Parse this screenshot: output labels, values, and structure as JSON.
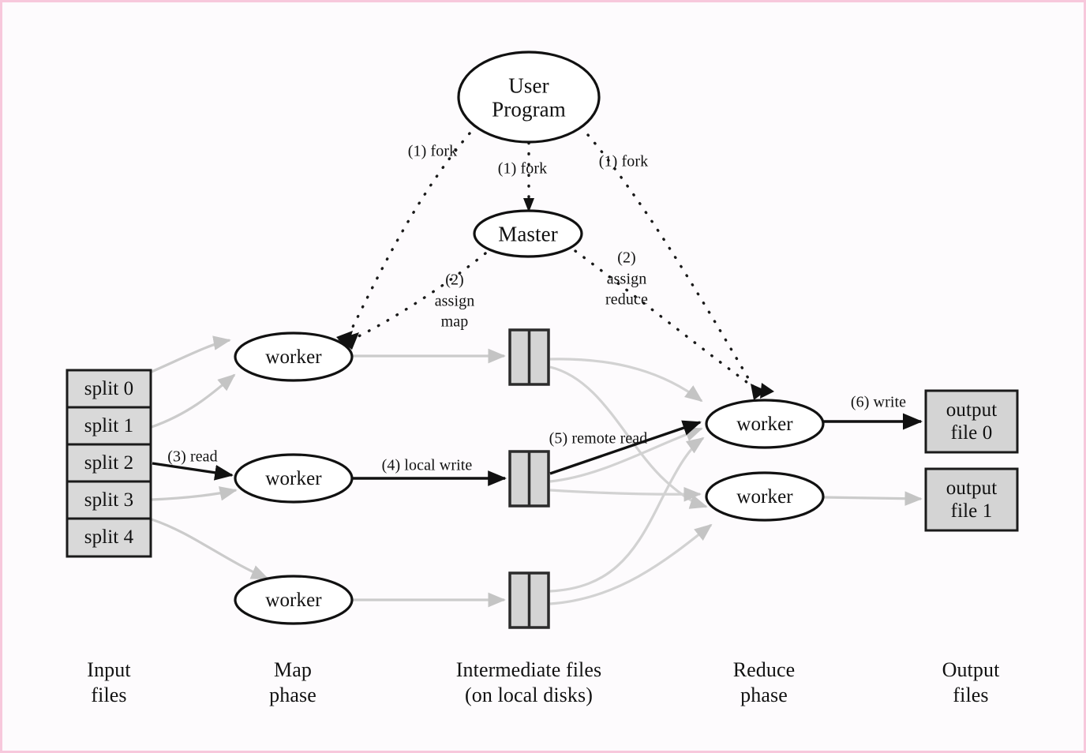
{
  "figure": {
    "title_semantic": "MapReduce execution overview",
    "colors": {
      "background": "#fdfbfd",
      "border": "#f7c8dc",
      "stroke_dark": "#111111",
      "stroke_light": "#c9c9c9",
      "box_fill": "#d4d4d4",
      "node_fill": "#ffffff"
    }
  },
  "nodes": {
    "user_program": {
      "label": "User\nProgram",
      "line1": "User",
      "line2": "Program"
    },
    "master": {
      "label": "Master"
    },
    "map_workers": [
      {
        "label": "worker"
      },
      {
        "label": "worker"
      },
      {
        "label": "worker"
      }
    ],
    "reduce_workers": [
      {
        "label": "worker"
      },
      {
        "label": "worker"
      }
    ]
  },
  "input_files": {
    "splits": [
      {
        "label": "split 0"
      },
      {
        "label": "split 1"
      },
      {
        "label": "split 2"
      },
      {
        "label": "split 3"
      },
      {
        "label": "split 4"
      }
    ]
  },
  "intermediate_files": {
    "count": 3,
    "partitions_per_file": 2
  },
  "output_files": [
    {
      "line1": "output",
      "line2": "file 0"
    },
    {
      "line1": "output",
      "line2": "file 1"
    }
  ],
  "edge_labels": {
    "fork_left": "(1) fork",
    "fork_middle": "(1) fork",
    "fork_right": "(1) fork",
    "assign_map": "(2)\nassign\nmap",
    "assign_map_l1": "(2)",
    "assign_map_l2": "assign",
    "assign_map_l3": "map",
    "assign_reduce_l1": "(2)",
    "assign_reduce_l2": "assign",
    "assign_reduce_l3": "reduce",
    "read": "(3) read",
    "local_write": "(4) local write",
    "remote_read": "(5) remote read",
    "write": "(6) write"
  },
  "column_labels": [
    {
      "line1": "Input",
      "line2": "files"
    },
    {
      "line1": "Map",
      "line2": "phase"
    },
    {
      "line1": "Intermediate files",
      "line2": "(on local disks)"
    },
    {
      "line1": "Reduce",
      "line2": "phase"
    },
    {
      "line1": "Output",
      "line2": "files"
    }
  ]
}
